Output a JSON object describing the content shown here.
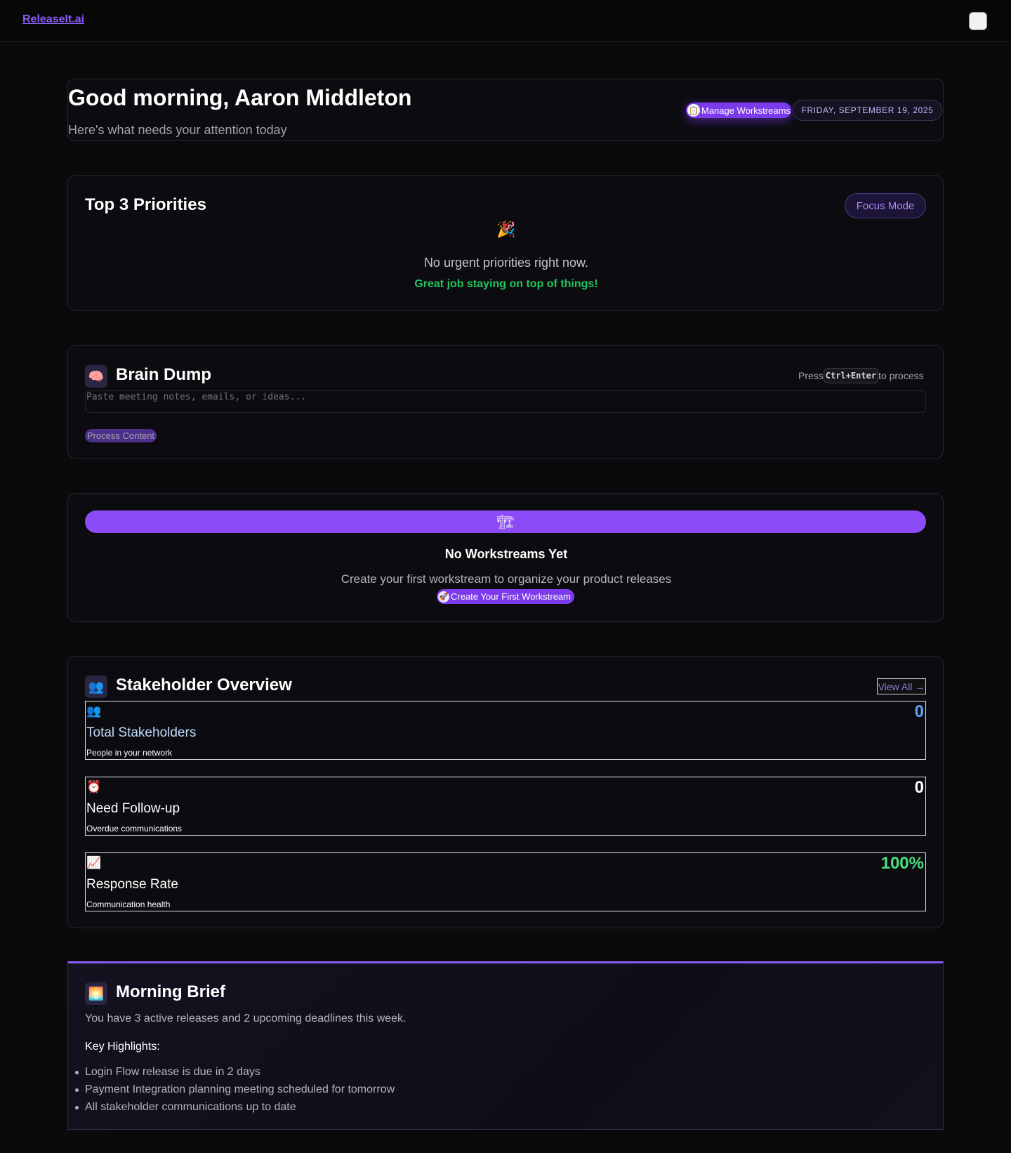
{
  "nav": {
    "brand": "ReleaseIt.ai"
  },
  "header": {
    "greeting": "Good morning, Aaron Middleton",
    "subtitle": "Here's what needs your attention today",
    "manage_label": "Manage Workstreams",
    "manage_icon": "📋",
    "date": "FRIDAY, SEPTEMBER 19, 2025"
  },
  "priorities": {
    "title": "Top 3 Priorities",
    "focus_label": "Focus Mode",
    "icon": "🎉",
    "empty_text": "No urgent priorities right now.",
    "praise_text": "Great job staying on top of things!"
  },
  "brain_dump": {
    "icon": "🧠",
    "title": "Brain Dump",
    "hint_pre": "Press",
    "hint_key": "Ctrl+Enter",
    "hint_post": "to process",
    "placeholder": "Paste meeting notes, emails, or ideas...",
    "process_label": "Process Content"
  },
  "workstreams": {
    "icon": "🏗",
    "title": "No Workstreams Yet",
    "description": "Create your first workstream to organize your product releases",
    "create_icon": "🚀",
    "create_label": "Create Your First Workstream"
  },
  "stakeholders": {
    "icon": "👥",
    "title": "Stakeholder Overview",
    "view_all": "View All →",
    "stats": [
      {
        "icon": "👥",
        "value": "0",
        "label": "Total Stakeholders",
        "sub": "People in your network",
        "color": "#60a5fa",
        "label_color": "#bfdbfe"
      },
      {
        "icon": "⏰",
        "value": "0",
        "label": "Need Follow-up",
        "sub": "Overdue communications",
        "color": "#ffffff",
        "label_color": "#ffffff"
      },
      {
        "icon": "📈",
        "value": "100%",
        "label": "Response Rate",
        "sub": "Communication health",
        "color": "#4ade80",
        "label_color": "#ffffff"
      }
    ]
  },
  "brief": {
    "icon": "🌅",
    "title": "Morning Brief",
    "intro": "You have 3 active releases and 2 upcoming deadlines this week.",
    "key_title": "Key Highlights:",
    "highlights": [
      "Login Flow release is due in 2 days",
      "Payment Integration planning meeting scheduled for tomorrow",
      "All stakeholder communications up to date"
    ]
  }
}
